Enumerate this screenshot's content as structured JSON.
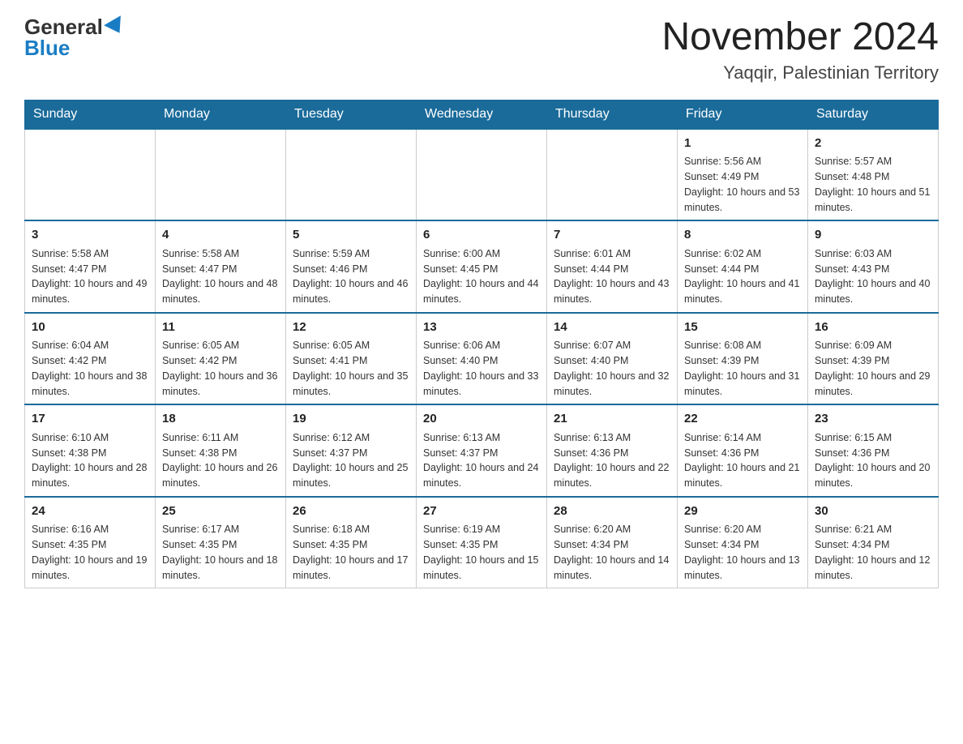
{
  "header": {
    "logo_general": "General",
    "logo_blue": "Blue",
    "month_title": "November 2024",
    "location": "Yaqqir, Palestinian Territory"
  },
  "weekdays": [
    "Sunday",
    "Monday",
    "Tuesday",
    "Wednesday",
    "Thursday",
    "Friday",
    "Saturday"
  ],
  "weeks": [
    [
      {
        "day": "",
        "info": ""
      },
      {
        "day": "",
        "info": ""
      },
      {
        "day": "",
        "info": ""
      },
      {
        "day": "",
        "info": ""
      },
      {
        "day": "",
        "info": ""
      },
      {
        "day": "1",
        "info": "Sunrise: 5:56 AM\nSunset: 4:49 PM\nDaylight: 10 hours and 53 minutes."
      },
      {
        "day": "2",
        "info": "Sunrise: 5:57 AM\nSunset: 4:48 PM\nDaylight: 10 hours and 51 minutes."
      }
    ],
    [
      {
        "day": "3",
        "info": "Sunrise: 5:58 AM\nSunset: 4:47 PM\nDaylight: 10 hours and 49 minutes."
      },
      {
        "day": "4",
        "info": "Sunrise: 5:58 AM\nSunset: 4:47 PM\nDaylight: 10 hours and 48 minutes."
      },
      {
        "day": "5",
        "info": "Sunrise: 5:59 AM\nSunset: 4:46 PM\nDaylight: 10 hours and 46 minutes."
      },
      {
        "day": "6",
        "info": "Sunrise: 6:00 AM\nSunset: 4:45 PM\nDaylight: 10 hours and 44 minutes."
      },
      {
        "day": "7",
        "info": "Sunrise: 6:01 AM\nSunset: 4:44 PM\nDaylight: 10 hours and 43 minutes."
      },
      {
        "day": "8",
        "info": "Sunrise: 6:02 AM\nSunset: 4:44 PM\nDaylight: 10 hours and 41 minutes."
      },
      {
        "day": "9",
        "info": "Sunrise: 6:03 AM\nSunset: 4:43 PM\nDaylight: 10 hours and 40 minutes."
      }
    ],
    [
      {
        "day": "10",
        "info": "Sunrise: 6:04 AM\nSunset: 4:42 PM\nDaylight: 10 hours and 38 minutes."
      },
      {
        "day": "11",
        "info": "Sunrise: 6:05 AM\nSunset: 4:42 PM\nDaylight: 10 hours and 36 minutes."
      },
      {
        "day": "12",
        "info": "Sunrise: 6:05 AM\nSunset: 4:41 PM\nDaylight: 10 hours and 35 minutes."
      },
      {
        "day": "13",
        "info": "Sunrise: 6:06 AM\nSunset: 4:40 PM\nDaylight: 10 hours and 33 minutes."
      },
      {
        "day": "14",
        "info": "Sunrise: 6:07 AM\nSunset: 4:40 PM\nDaylight: 10 hours and 32 minutes."
      },
      {
        "day": "15",
        "info": "Sunrise: 6:08 AM\nSunset: 4:39 PM\nDaylight: 10 hours and 31 minutes."
      },
      {
        "day": "16",
        "info": "Sunrise: 6:09 AM\nSunset: 4:39 PM\nDaylight: 10 hours and 29 minutes."
      }
    ],
    [
      {
        "day": "17",
        "info": "Sunrise: 6:10 AM\nSunset: 4:38 PM\nDaylight: 10 hours and 28 minutes."
      },
      {
        "day": "18",
        "info": "Sunrise: 6:11 AM\nSunset: 4:38 PM\nDaylight: 10 hours and 26 minutes."
      },
      {
        "day": "19",
        "info": "Sunrise: 6:12 AM\nSunset: 4:37 PM\nDaylight: 10 hours and 25 minutes."
      },
      {
        "day": "20",
        "info": "Sunrise: 6:13 AM\nSunset: 4:37 PM\nDaylight: 10 hours and 24 minutes."
      },
      {
        "day": "21",
        "info": "Sunrise: 6:13 AM\nSunset: 4:36 PM\nDaylight: 10 hours and 22 minutes."
      },
      {
        "day": "22",
        "info": "Sunrise: 6:14 AM\nSunset: 4:36 PM\nDaylight: 10 hours and 21 minutes."
      },
      {
        "day": "23",
        "info": "Sunrise: 6:15 AM\nSunset: 4:36 PM\nDaylight: 10 hours and 20 minutes."
      }
    ],
    [
      {
        "day": "24",
        "info": "Sunrise: 6:16 AM\nSunset: 4:35 PM\nDaylight: 10 hours and 19 minutes."
      },
      {
        "day": "25",
        "info": "Sunrise: 6:17 AM\nSunset: 4:35 PM\nDaylight: 10 hours and 18 minutes."
      },
      {
        "day": "26",
        "info": "Sunrise: 6:18 AM\nSunset: 4:35 PM\nDaylight: 10 hours and 17 minutes."
      },
      {
        "day": "27",
        "info": "Sunrise: 6:19 AM\nSunset: 4:35 PM\nDaylight: 10 hours and 15 minutes."
      },
      {
        "day": "28",
        "info": "Sunrise: 6:20 AM\nSunset: 4:34 PM\nDaylight: 10 hours and 14 minutes."
      },
      {
        "day": "29",
        "info": "Sunrise: 6:20 AM\nSunset: 4:34 PM\nDaylight: 10 hours and 13 minutes."
      },
      {
        "day": "30",
        "info": "Sunrise: 6:21 AM\nSunset: 4:34 PM\nDaylight: 10 hours and 12 minutes."
      }
    ]
  ]
}
